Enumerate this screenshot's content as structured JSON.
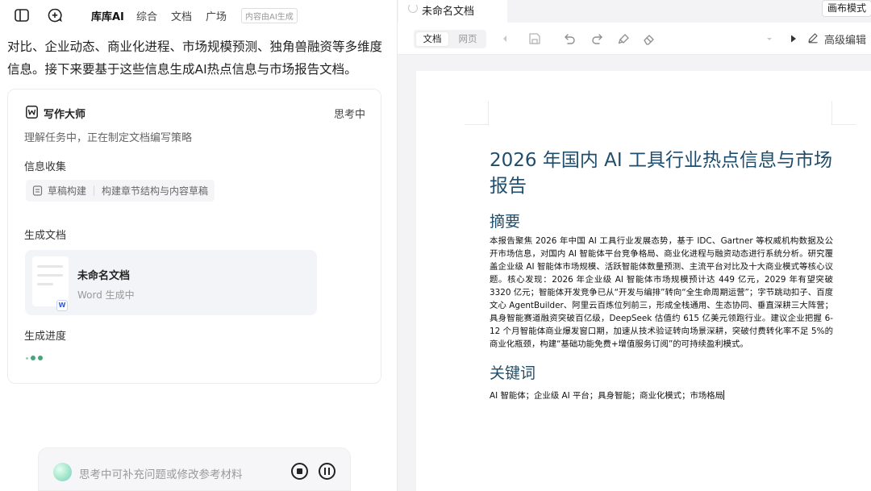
{
  "topbar": {
    "nav": [
      "库库AI",
      "综合",
      "文档",
      "广场"
    ],
    "ai_tag": "内容由AI生成"
  },
  "intro_text": "对比、企业动态、商业化进程、市场规模预测、独角兽融资等多维度信息。接下来要基于这些信息生成AI热点信息与市场报告文档。",
  "task_card": {
    "title": "写作大师",
    "status": "思考中",
    "subtitle": "理解任务中，正在制定文档编写策略",
    "info_label": "信息收集",
    "chip_left": "草稿构建",
    "chip_right": "构建章节结构与内容草稿",
    "gen_doc_label": "生成文档",
    "doc_name": "未命名文档",
    "doc_status": "Word 生成中",
    "progress_label": "生成进度"
  },
  "input": {
    "placeholder": "思考中可补充问题或修改参考材料"
  },
  "editor": {
    "tab_title": "未命名文档",
    "canvas_mode": "画布模式",
    "seg": [
      "文档",
      "网页"
    ],
    "advanced_edit": "高级编辑"
  },
  "document": {
    "title": "2026 年国内 AI 工具行业热点信息与市场报告",
    "abstract_heading": "摘要",
    "abstract": "本报告聚焦 2026 年中国 AI 工具行业发展态势，基于 IDC、Gartner 等权威机构数据及公开市场信息，对国内 AI 智能体平台竞争格局、商业化进程与融资动态进行系统分析。研究覆盖企业级 AI 智能体市场规模、活跃智能体数量预测、主流平台对比及十大商业模式等核心议题。核心发现：2026 年企业级 AI 智能体市场规模预计达 449 亿元，2029 年有望突破 3320 亿元；智能体开发竞争已从“开发与编排”转向“全生命周期运营”；字节跳动扣子、百度文心 AgentBuilder、阿里云百炼位列前三，形成全栈通用、生态协同、垂直深耕三大阵营；具身智能赛道融资突破百亿级，DeepSeek 估值约 615 亿美元领跑行业。建议企业把握 6-12 个月智能体商业爆发窗口期，加速从技术验证转向场景深耕，突破付费转化率不足 5%的商业化瓶颈，构建“基础功能免费+增值服务订阅”的可持续盈利模式。",
    "keywords_heading": "关键词",
    "keywords": "AI 智能体；企业级 AI 平台；具身智能；商业化模式；市场格局"
  }
}
